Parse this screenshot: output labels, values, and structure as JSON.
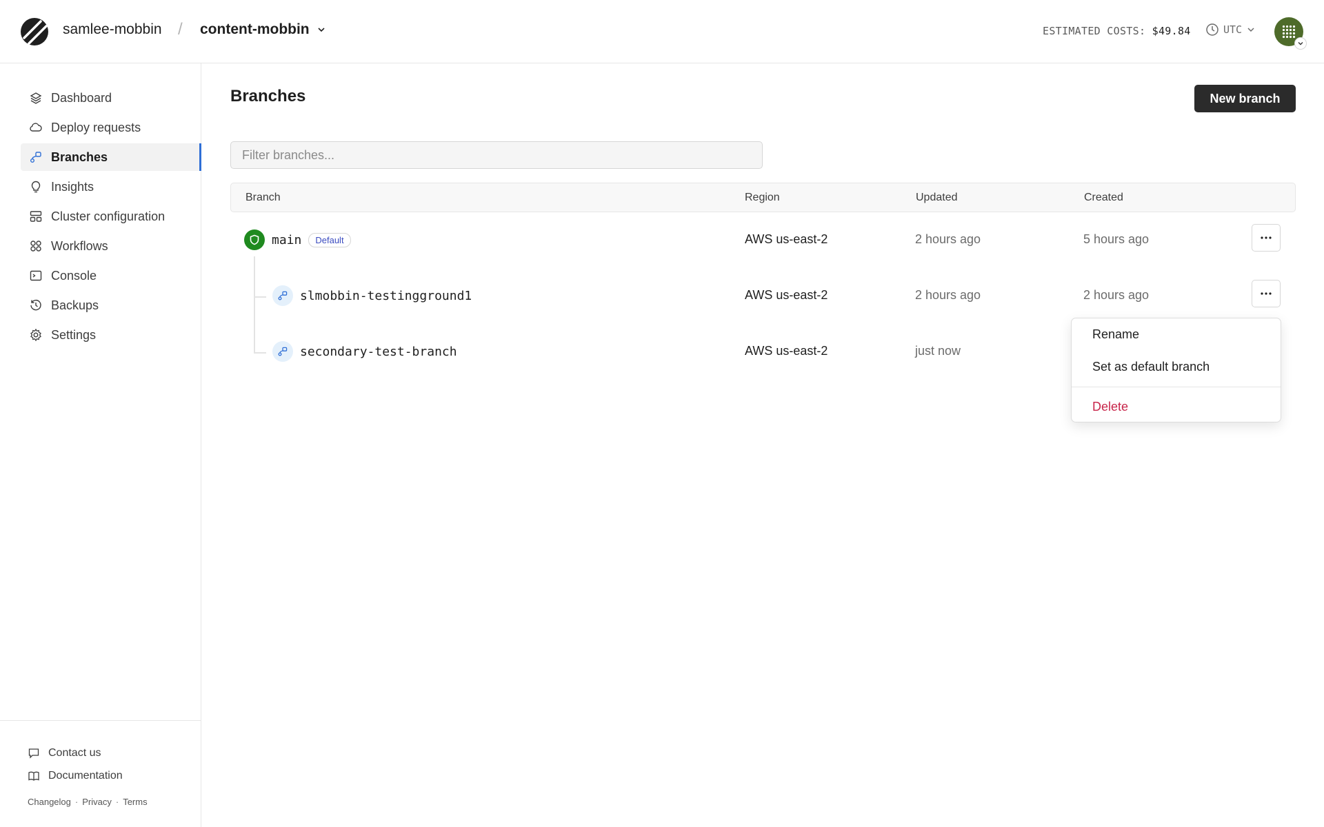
{
  "header": {
    "org_name": "samlee-mobbin",
    "separator": "/",
    "database_name": "content-mobbin",
    "costs_label": "ESTIMATED COSTS:",
    "costs_value": "$49.84",
    "timezone": "UTC"
  },
  "sidebar": {
    "items": [
      {
        "label": "Dashboard",
        "icon": "layers-icon"
      },
      {
        "label": "Deploy requests",
        "icon": "cloud-icon"
      },
      {
        "label": "Branches",
        "icon": "branch-icon",
        "active": true
      },
      {
        "label": "Insights",
        "icon": "lightbulb-icon"
      },
      {
        "label": "Cluster configuration",
        "icon": "cluster-icon"
      },
      {
        "label": "Workflows",
        "icon": "workflows-icon"
      },
      {
        "label": "Console",
        "icon": "terminal-icon"
      },
      {
        "label": "Backups",
        "icon": "backup-icon"
      },
      {
        "label": "Settings",
        "icon": "gear-icon"
      }
    ],
    "bottom": {
      "contact": "Contact us",
      "docs": "Documentation",
      "changelog": "Changelog",
      "privacy": "Privacy",
      "terms": "Terms",
      "dot": "·"
    }
  },
  "main": {
    "title": "Branches",
    "new_branch_label": "New branch",
    "filter_placeholder": "Filter branches...",
    "columns": {
      "branch": "Branch",
      "region": "Region",
      "updated": "Updated",
      "created": "Created"
    },
    "rows": [
      {
        "name": "main",
        "badge": "Default",
        "region": "AWS us-east-2",
        "updated": "2 hours ago",
        "created": "5 hours ago"
      },
      {
        "name": "slmobbin-testingground1",
        "region": "AWS us-east-2",
        "updated": "2 hours ago",
        "created": "2 hours ago"
      },
      {
        "name": "secondary-test-branch",
        "region": "AWS us-east-2",
        "updated": "just now",
        "created": ""
      }
    ]
  },
  "menu": {
    "rename": "Rename",
    "set_default": "Set as default branch",
    "delete": "Delete"
  },
  "colors": {
    "accent": "#2f6fd6",
    "primary_button": "#2b2b2b",
    "danger": "#c8254a",
    "main_branch_icon": "#1f8a1f"
  }
}
